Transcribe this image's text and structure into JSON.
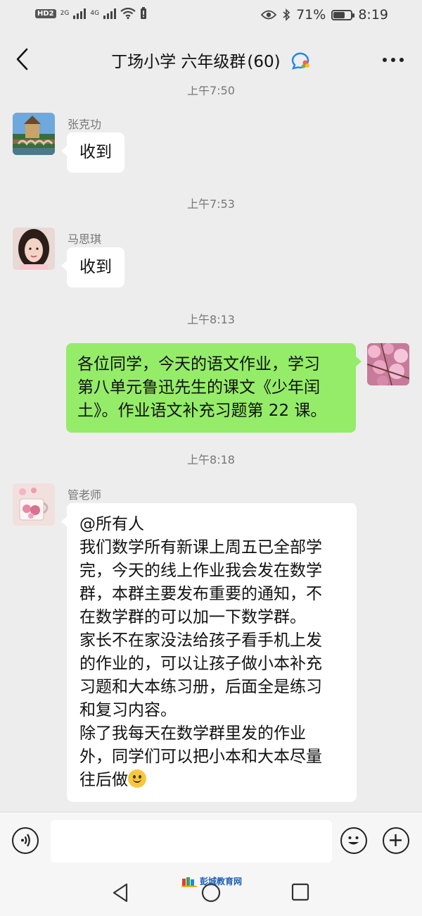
{
  "status_bar": {
    "hd": "HD",
    "hd_sub": "2",
    "net1": "2G",
    "net2": "4G",
    "battery_text": "71%",
    "battery_level": 0.71,
    "time": "8:19"
  },
  "header": {
    "title": "丁场小学 六年级群",
    "member_count": "(60)"
  },
  "messages": [
    {
      "time_partial": "上午7:50"
    },
    {
      "sender": "张克功",
      "text": "收到"
    },
    {
      "time": "上午7:53"
    },
    {
      "sender": "马思琪",
      "text": "收到"
    },
    {
      "time": "上午8:13"
    },
    {
      "self": true,
      "lines": [
        "各位同学，今天的语文作业，学习",
        "第八单元鲁迅先生的课文《少年闰",
        "土》。作业语文补充习题第 22 课。"
      ]
    },
    {
      "time": "上午8:18"
    },
    {
      "sender": "管老师",
      "lines": [
        "@所有人",
        "我们数学所有新课上周五已全部学",
        "完，今天的线上作业我会发在数学",
        "群，本群主要发布重要的通知，不",
        "在数学群的可以加一下数学群。",
        "家长不在家没法给孩子看手机上发",
        "的作业的，可以让孩子做小本补充",
        "习题和大本练习册，后面全是练习",
        "和复习内容。",
        "除了我每天在数学群里发的作业",
        "外，同学们可以把小本和大本尽量",
        "往后做"
      ]
    }
  ],
  "input": {
    "placeholder": ""
  },
  "watermark": "彭城教育网",
  "colors": {
    "self_bubble": "#95ec69",
    "background": "#ededed"
  }
}
